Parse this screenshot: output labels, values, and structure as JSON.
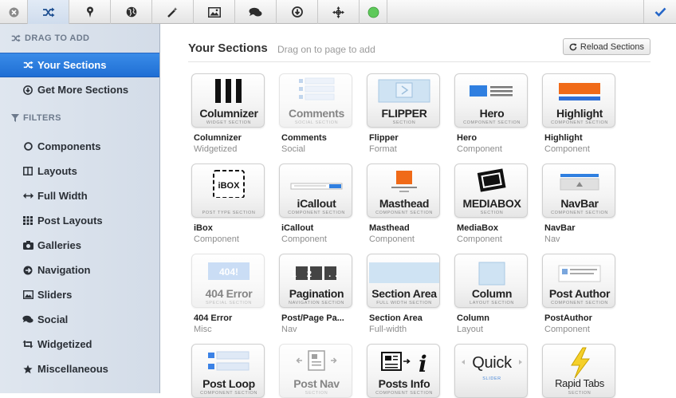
{
  "toolbar": {
    "buttons": [
      {
        "name": "close-icon"
      },
      {
        "name": "shuffle-icon"
      },
      {
        "name": "map-pin-icon"
      },
      {
        "name": "globe-icon"
      },
      {
        "name": "magic-wand-icon"
      },
      {
        "name": "image-icon"
      },
      {
        "name": "comments-icon"
      },
      {
        "name": "download-icon"
      },
      {
        "name": "move-icon"
      },
      {
        "name": "status-dot-icon"
      },
      {
        "name": "check-icon"
      }
    ],
    "status_color": "#5ec95a",
    "check_color": "#2566c8"
  },
  "sidebar": {
    "drag_heading": "DRAG TO ADD",
    "nav": [
      {
        "label": "Your Sections",
        "icon": "shuffle-icon",
        "active": true
      },
      {
        "label": "Get More Sections",
        "icon": "download-circle-icon",
        "active": false
      }
    ],
    "filters_heading": "FILTERS",
    "filters": [
      {
        "label": "Components",
        "icon": "circle-icon"
      },
      {
        "label": "Layouts",
        "icon": "columns-icon"
      },
      {
        "label": "Full Width",
        "icon": "arrows-horizontal-icon"
      },
      {
        "label": "Post Layouts",
        "icon": "grid-icon"
      },
      {
        "label": "Galleries",
        "icon": "camera-icon"
      },
      {
        "label": "Navigation",
        "icon": "arrow-circle-icon"
      },
      {
        "label": "Sliders",
        "icon": "picture-icon"
      },
      {
        "label": "Social",
        "icon": "comments-icon"
      },
      {
        "label": "Widgetized",
        "icon": "retweet-icon"
      },
      {
        "label": "Miscellaneous",
        "icon": "star-icon"
      }
    ]
  },
  "main": {
    "title": "Your Sections",
    "subtitle": "Drag on to page to add",
    "reload_label": "Reload Sections",
    "sections": [
      {
        "tile_title": "Columnizer",
        "tile_tag": "Widget Section",
        "name": "Columnizer",
        "category": "Widgetized",
        "graphic": "columnizer"
      },
      {
        "tile_title": "Comments",
        "tile_tag": "Social Section",
        "name": "Comments",
        "category": "Social",
        "graphic": "comments",
        "faded": true
      },
      {
        "tile_title": "FLIPPER",
        "tile_tag": "Section",
        "name": "Flipper",
        "category": "Format",
        "graphic": "flipper"
      },
      {
        "tile_title": "Hero",
        "tile_tag": "Component Section",
        "name": "Hero",
        "category": "Component",
        "graphic": "hero"
      },
      {
        "tile_title": "Highlight",
        "tile_tag": "Component Section",
        "name": "Highlight",
        "category": "Component",
        "graphic": "highlight"
      },
      {
        "tile_title": "",
        "tile_tag": "Post Type Section",
        "name": "iBox",
        "category": "Component",
        "graphic": "ibox",
        "graphic_text": "iBOX"
      },
      {
        "tile_title": "iCallout",
        "tile_tag": "Component Section",
        "name": "iCallout",
        "category": "Component",
        "graphic": "icallout"
      },
      {
        "tile_title": "Masthead",
        "tile_tag": "Component Section",
        "name": "Masthead",
        "category": "Component",
        "graphic": "masthead"
      },
      {
        "tile_title": "MEDIABOX",
        "tile_tag": "Section",
        "name": "MediaBox",
        "category": "Component",
        "graphic": "mediabox"
      },
      {
        "tile_title": "NavBar",
        "tile_tag": "Component Section",
        "name": "NavBar",
        "category": "Nav",
        "graphic": "navbar"
      },
      {
        "tile_title": "404 Error",
        "tile_tag": "Special Section",
        "name": "404 Error",
        "category": "Misc",
        "graphic": "error404",
        "graphic_text": "404!",
        "faded": true
      },
      {
        "tile_title": "Pagination",
        "tile_tag": "Navigation Section",
        "name": "Post/Page Pa...",
        "category": "Nav",
        "graphic": "pagination",
        "graphic_text": "1 2 ..."
      },
      {
        "tile_title": "Section Area",
        "tile_tag": "Full Width Section",
        "name": "Section Area",
        "category": "Full-width",
        "graphic": "sectionarea"
      },
      {
        "tile_title": "Column",
        "tile_tag": "Layout Section",
        "name": "Column",
        "category": "Layout",
        "graphic": "column"
      },
      {
        "tile_title": "Post Author",
        "tile_tag": "Component Section",
        "name": "PostAuthor",
        "category": "Component",
        "graphic": "postauthor"
      },
      {
        "tile_title": "Post Loop",
        "tile_tag": "Component Section",
        "name": "",
        "category": "",
        "graphic": "postloop"
      },
      {
        "tile_title": "Post Nav",
        "tile_tag": "Section",
        "name": "",
        "category": "",
        "graphic": "postnav",
        "faded": true
      },
      {
        "tile_title": "Posts Info",
        "tile_tag": "Component Section",
        "name": "",
        "category": "",
        "graphic": "postsinfo"
      },
      {
        "tile_title": "Quick",
        "tile_tag": "Slider",
        "name": "",
        "category": "",
        "graphic": "quick"
      },
      {
        "tile_title": "Rapid Tabs",
        "tile_tag": "Section",
        "name": "",
        "category": "",
        "graphic": "rapidtabs"
      }
    ]
  }
}
